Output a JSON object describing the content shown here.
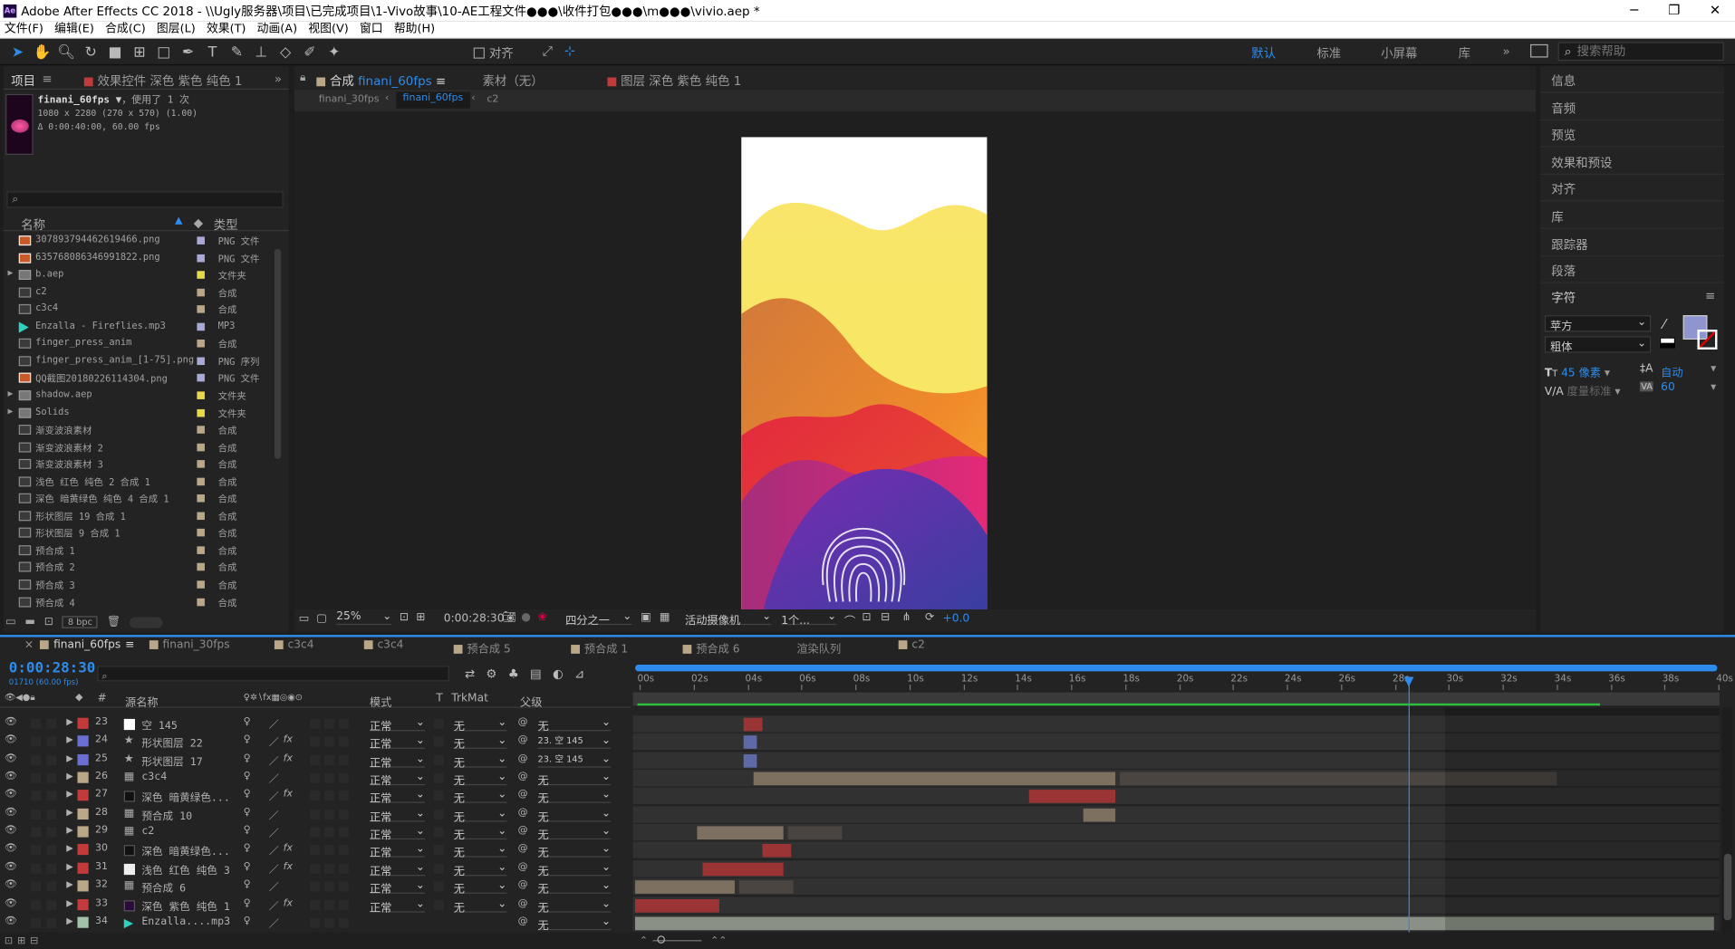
{
  "title_bar": {
    "app_logo": "Ae",
    "title": "Adobe After Effects CC 2018 - \\\\Ugly服务器\\项目\\已完成项目\\1-Vivo故事\\10-AE工程文件●●●\\收件打包●●●\\m●●●\\vivio.aep *",
    "minimize": "─",
    "maximize": "❐",
    "close": "✕"
  },
  "menu": [
    "文件(F)",
    "编辑(E)",
    "合成(C)",
    "图层(L)",
    "效果(T)",
    "动画(A)",
    "视图(V)",
    "窗口",
    "帮助(H)"
  ],
  "toolbar": {
    "align_label": "对齐",
    "workspaces": [
      "默认",
      "标准",
      "小屏幕",
      "库"
    ],
    "active_workspace": "默认",
    "more": "»",
    "search_placeholder": "搜索帮助"
  },
  "project_panel": {
    "tab_project": "项目",
    "tab_menu": "≡",
    "tab_effects": "效果控件 深色 紫色 纯色 1",
    "expand": "»",
    "thumb_name": "finani_60fps",
    "thumb_used": "，使用了 1 次",
    "thumb_size": "1080 x 2280  (270 x 570) (1.00)",
    "thumb_duration": "Δ 0:00:40:00, 60.00 fps",
    "search_placeholder": "",
    "col_name": "名称",
    "col_type": "类型",
    "items": [
      {
        "name": "307893794462619466.png",
        "type": "PNG 文件",
        "label": "#a9a9d8",
        "icon": "png",
        "arrow": ""
      },
      {
        "name": "635768086346991822.png",
        "type": "PNG 文件",
        "label": "#a9a9d8",
        "icon": "png",
        "arrow": ""
      },
      {
        "name": "b.aep",
        "type": "文件夹",
        "label": "#e6d84a",
        "icon": "folder",
        "arrow": "▶"
      },
      {
        "name": "c2",
        "type": "合成",
        "label": "#b9a787",
        "icon": "comp",
        "arrow": ""
      },
      {
        "name": "c3c4",
        "type": "合成",
        "label": "#b9a787",
        "icon": "comp",
        "arrow": ""
      },
      {
        "name": "Enzalla - Fireflies.mp3",
        "type": "MP3",
        "label": "#a9a9d8",
        "icon": "audio",
        "arrow": ""
      },
      {
        "name": "finger_press_anim",
        "type": "合成",
        "label": "#b9a787",
        "icon": "comp",
        "arrow": ""
      },
      {
        "name": "finger_press_anim_[1-75].png",
        "type": "PNG 序列",
        "label": "#a9a9d8",
        "icon": "comp",
        "arrow": ""
      },
      {
        "name": "QQ截图20180226114304.png",
        "type": "PNG 文件",
        "label": "#a9a9d8",
        "icon": "png",
        "arrow": ""
      },
      {
        "name": "shadow.aep",
        "type": "文件夹",
        "label": "#e6d84a",
        "icon": "folder",
        "arrow": "▶"
      },
      {
        "name": "Solids",
        "type": "文件夹",
        "label": "#e6d84a",
        "icon": "folder",
        "arrow": "▶"
      },
      {
        "name": "渐变波浪素材",
        "type": "合成",
        "label": "#b9a787",
        "icon": "comp",
        "arrow": ""
      },
      {
        "name": "渐变波浪素材 2",
        "type": "合成",
        "label": "#b9a787",
        "icon": "comp",
        "arrow": ""
      },
      {
        "name": "渐变波浪素材 3",
        "type": "合成",
        "label": "#b9a787",
        "icon": "comp",
        "arrow": ""
      },
      {
        "name": "浅色 红色 纯色 2 合成 1",
        "type": "合成",
        "label": "#b9a787",
        "icon": "comp",
        "arrow": ""
      },
      {
        "name": "深色 暗黄绿色 纯色 4 合成 1",
        "type": "合成",
        "label": "#b9a787",
        "icon": "comp",
        "arrow": ""
      },
      {
        "name": "形状图层 19 合成 1",
        "type": "合成",
        "label": "#b9a787",
        "icon": "comp",
        "arrow": ""
      },
      {
        "name": "形状图层 9 合成 1",
        "type": "合成",
        "label": "#b9a787",
        "icon": "comp",
        "arrow": ""
      },
      {
        "name": "预合成 1",
        "type": "合成",
        "label": "#b9a787",
        "icon": "comp",
        "arrow": ""
      },
      {
        "name": "预合成 2",
        "type": "合成",
        "label": "#b9a787",
        "icon": "comp",
        "arrow": ""
      },
      {
        "name": "预合成 3",
        "type": "合成",
        "label": "#b9a787",
        "icon": "comp",
        "arrow": ""
      },
      {
        "name": "预合成 4",
        "type": "合成",
        "label": "#b9a787",
        "icon": "comp",
        "arrow": ""
      }
    ],
    "bpc": "8 bpc"
  },
  "comp_panel": {
    "tab_comp": "合成",
    "tab_comp_name": "finani_60fps",
    "tab_footage": "素材（无）",
    "tab_layer": "图层 深色 紫色 纯色 1",
    "breadcrumbs": [
      "finani_30fps",
      "finani_60fps",
      "c2"
    ],
    "zoom": "25%",
    "timecode": "0:00:28:30",
    "resolution": "四分之一",
    "camera": "活动摄像机",
    "views": "1个...",
    "exposure": "+0.0"
  },
  "right_panel": {
    "items": [
      "信息",
      "音频",
      "预览",
      "效果和预设",
      "对齐",
      "库",
      "跟踪器",
      "段落"
    ],
    "char_title": "字符",
    "font": "苹方",
    "style": "粗体",
    "size": "45 像素",
    "leading": "自动",
    "kerning": "度量标准",
    "tracking": "60",
    "fill_color": "#8e95cf"
  },
  "timeline": {
    "tabs": [
      {
        "label": "finani_60fps",
        "color": "#b9a787",
        "active": true
      },
      {
        "label": "finani_30fps",
        "color": "#b9a787"
      },
      {
        "label": "c3c4",
        "color": "#b9a787"
      },
      {
        "label": "c3c4",
        "color": "#b9a787"
      },
      {
        "label": "预合成 5",
        "color": "#b9a787"
      },
      {
        "label": "预合成 1",
        "color": "#b9a787"
      },
      {
        "label": "预合成 6",
        "color": "#b9a787"
      },
      {
        "label": "渲染队列",
        "color": ""
      },
      {
        "label": "c2",
        "color": "#b9a787"
      }
    ],
    "timecode": "0:00:28:30",
    "frame_info": "01710 (60.00 fps)",
    "col_source": "源名称",
    "col_mode": "模式",
    "col_t": "T",
    "col_trkmat": "TrkMat",
    "col_parent": "父级",
    "ruler": [
      "00s",
      "02s",
      "04s",
      "06s",
      "08s",
      "10s",
      "12s",
      "14s",
      "16s",
      "18s",
      "20s",
      "22s",
      "24s",
      "26s",
      "28s",
      "30s",
      "32s",
      "34s",
      "36s",
      "38s",
      "40s"
    ],
    "layers": [
      {
        "num": "23",
        "name": "空 145",
        "label": "#c23a3a",
        "icon": "null",
        "mode": "正常",
        "trk": "无",
        "parent": "无",
        "bar_start": 4.0,
        "bar_end": 4.7,
        "bar_color": "#9b3434"
      },
      {
        "num": "24",
        "name": "形状图层 22",
        "label": "#6b6fd1",
        "icon": "star",
        "mode": "正常",
        "trk": "无",
        "parent": "23. 空 145",
        "bar_start": 4.0,
        "bar_end": 4.5,
        "bar_color": "#5e6aa7"
      },
      {
        "num": "25",
        "name": "形状图层 17",
        "label": "#6b6fd1",
        "icon": "star",
        "mode": "正常",
        "trk": "无",
        "parent": "23. 空 145",
        "bar_start": 4.0,
        "bar_end": 4.5,
        "bar_color": "#5e6aa7"
      },
      {
        "num": "26",
        "name": "c3c4",
        "label": "#b9a787",
        "icon": "comp",
        "mode": "正常",
        "trk": "无",
        "parent": "无",
        "bar_start": 4.4,
        "bar_end": 17.8,
        "bar_color": "#7d7060",
        "ext_end": 34.0
      },
      {
        "num": "27",
        "name": "深色 暗黄绿色...",
        "label": "#c23a3a",
        "icon": "solid",
        "mode": "正常",
        "trk": "无",
        "parent": "无",
        "bar_start": 14.6,
        "bar_end": 17.8,
        "bar_color": "#9b3434"
      },
      {
        "num": "28",
        "name": "预合成 10",
        "label": "#b9a787",
        "icon": "comp",
        "mode": "正常",
        "trk": "无",
        "parent": "无",
        "bar_start": 16.6,
        "bar_end": 17.8,
        "bar_color": "#7d7060"
      },
      {
        "num": "29",
        "name": "c2",
        "label": "#b9a787",
        "icon": "comp",
        "mode": "正常",
        "trk": "无",
        "parent": "无",
        "bar_start": 2.3,
        "bar_end": 5.5,
        "bar_color": "#7d7060",
        "ext_end": 7.5
      },
      {
        "num": "30",
        "name": "深色 暗黄绿色...",
        "label": "#c23a3a",
        "icon": "solid",
        "mode": "正常",
        "trk": "无",
        "parent": "无",
        "bar_start": 4.7,
        "bar_end": 5.8,
        "bar_color": "#9b3434"
      },
      {
        "num": "31",
        "name": "浅色 红色 纯色 3",
        "label": "#c23a3a",
        "icon": "solidw",
        "mode": "正常",
        "trk": "无",
        "parent": "无",
        "bar_start": 2.5,
        "bar_end": 5.5,
        "bar_color": "#9b3434"
      },
      {
        "num": "32",
        "name": "预合成 6",
        "label": "#b9a787",
        "icon": "comp",
        "mode": "正常",
        "trk": "无",
        "parent": "无",
        "bar_start": 0.0,
        "bar_end": 3.7,
        "bar_color": "#7d7060",
        "ext_end": 5.7
      },
      {
        "num": "33",
        "name": "深色 紫色 纯色 1",
        "label": "#c23a3a",
        "icon": "solidp",
        "mode": "正常",
        "trk": "无",
        "parent": "无",
        "bar_start": 0.0,
        "bar_end": 3.1,
        "bar_color": "#9b3434"
      },
      {
        "num": "34",
        "name": "Enzalla....mp3",
        "label": "#a2c2a8",
        "icon": "audio",
        "mode": "",
        "trk": "",
        "parent": "无",
        "bar_start": 0.0,
        "bar_end": 40.0,
        "bar_color": "#8a9086"
      }
    ],
    "playhead_sec": 28.5
  }
}
